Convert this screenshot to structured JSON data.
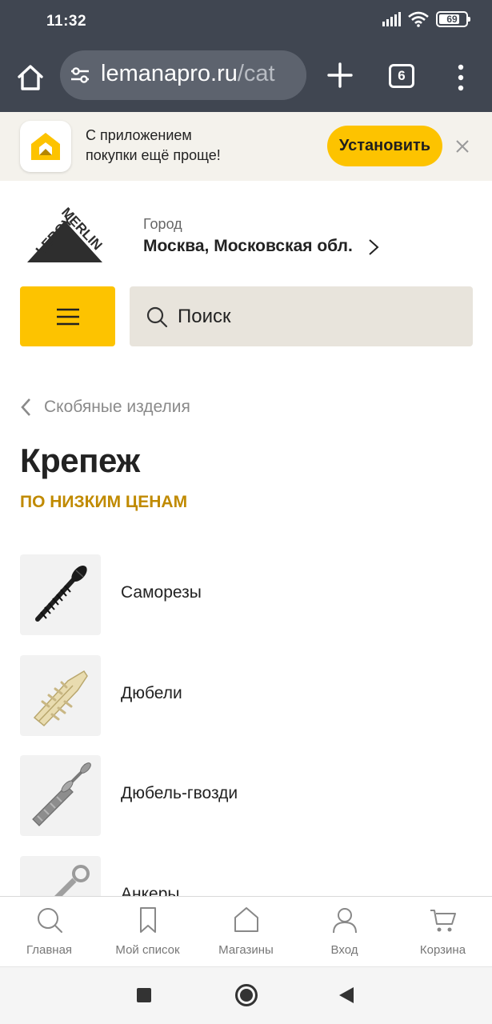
{
  "status_bar": {
    "time": "11:32",
    "battery_level": "69",
    "icons": [
      "signal-icon",
      "wifi-icon",
      "battery-icon"
    ]
  },
  "browser": {
    "url_main": "lemanapro.ru",
    "url_rest": "/cat",
    "tab_count": "6"
  },
  "app_banner": {
    "line1": "С приложением",
    "line2": "покупки ещё проще!",
    "install_label": "Установить"
  },
  "header": {
    "logo_text_1": "LEROY",
    "logo_text_2": "MERLIN",
    "city_label": "Город",
    "city_value": "Москва, Московская обл.",
    "search_placeholder": "Поиск"
  },
  "breadcrumb": {
    "back_label": "Скобяные изделия"
  },
  "page": {
    "title": "Крепеж",
    "subtitle": "ПО НИЗКИМ ЦЕНАМ"
  },
  "categories": [
    {
      "label": "Саморезы"
    },
    {
      "label": "Дюбели"
    },
    {
      "label": "Дюбель-гвозди"
    },
    {
      "label": "Анкеры"
    }
  ],
  "bottom_nav": [
    {
      "label": "Главная",
      "icon": "search-icon"
    },
    {
      "label": "Мой список",
      "icon": "bookmark-icon"
    },
    {
      "label": "Магазины",
      "icon": "store-icon"
    },
    {
      "label": "Вход",
      "icon": "user-icon"
    },
    {
      "label": "Корзина",
      "icon": "cart-icon"
    }
  ],
  "colors": {
    "accent_yellow": "#fdc300",
    "chrome_dark": "#404651",
    "subtitle_gold": "#c08a00"
  }
}
